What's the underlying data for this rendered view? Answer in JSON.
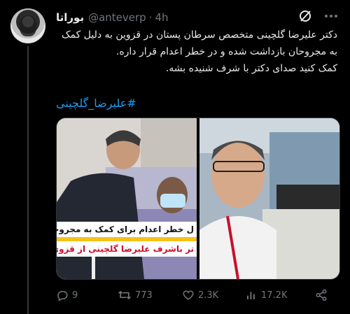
{
  "tweet": {
    "display_name": "بوراتا",
    "handle": "@anteverp",
    "separator": "·",
    "time": "4h",
    "lines": [
      "دکتر علیرضا گلچینی متخصص سرطان پستان در قزوین به دلیل کمک به مجروحان بازداشت شده و در خطر اعدام قرار داره.",
      "کمک کنید صدای دکتر با شرف شنیده بشه."
    ],
    "hashtag": "#علیرضا_گلچینی"
  },
  "media": {
    "banner_line_1": "ل خطر اعدام برای کمک به مجروحین",
    "banner_line_2": "تر باشرف علیرضا گلچینی از قزوی"
  },
  "actions": {
    "replies": "9",
    "retweets": "773",
    "likes": "2.3K",
    "views": "17.2K"
  },
  "icons": {
    "grok": "grok-icon",
    "more": "more-icon",
    "reply": "reply-icon",
    "retweet": "retweet-icon",
    "like": "heart-icon",
    "views": "views-icon",
    "share": "share-icon"
  },
  "colors": {
    "background": "#000000",
    "text": "#e7e9ea",
    "muted": "#71767b",
    "link": "#1d9bf0"
  }
}
